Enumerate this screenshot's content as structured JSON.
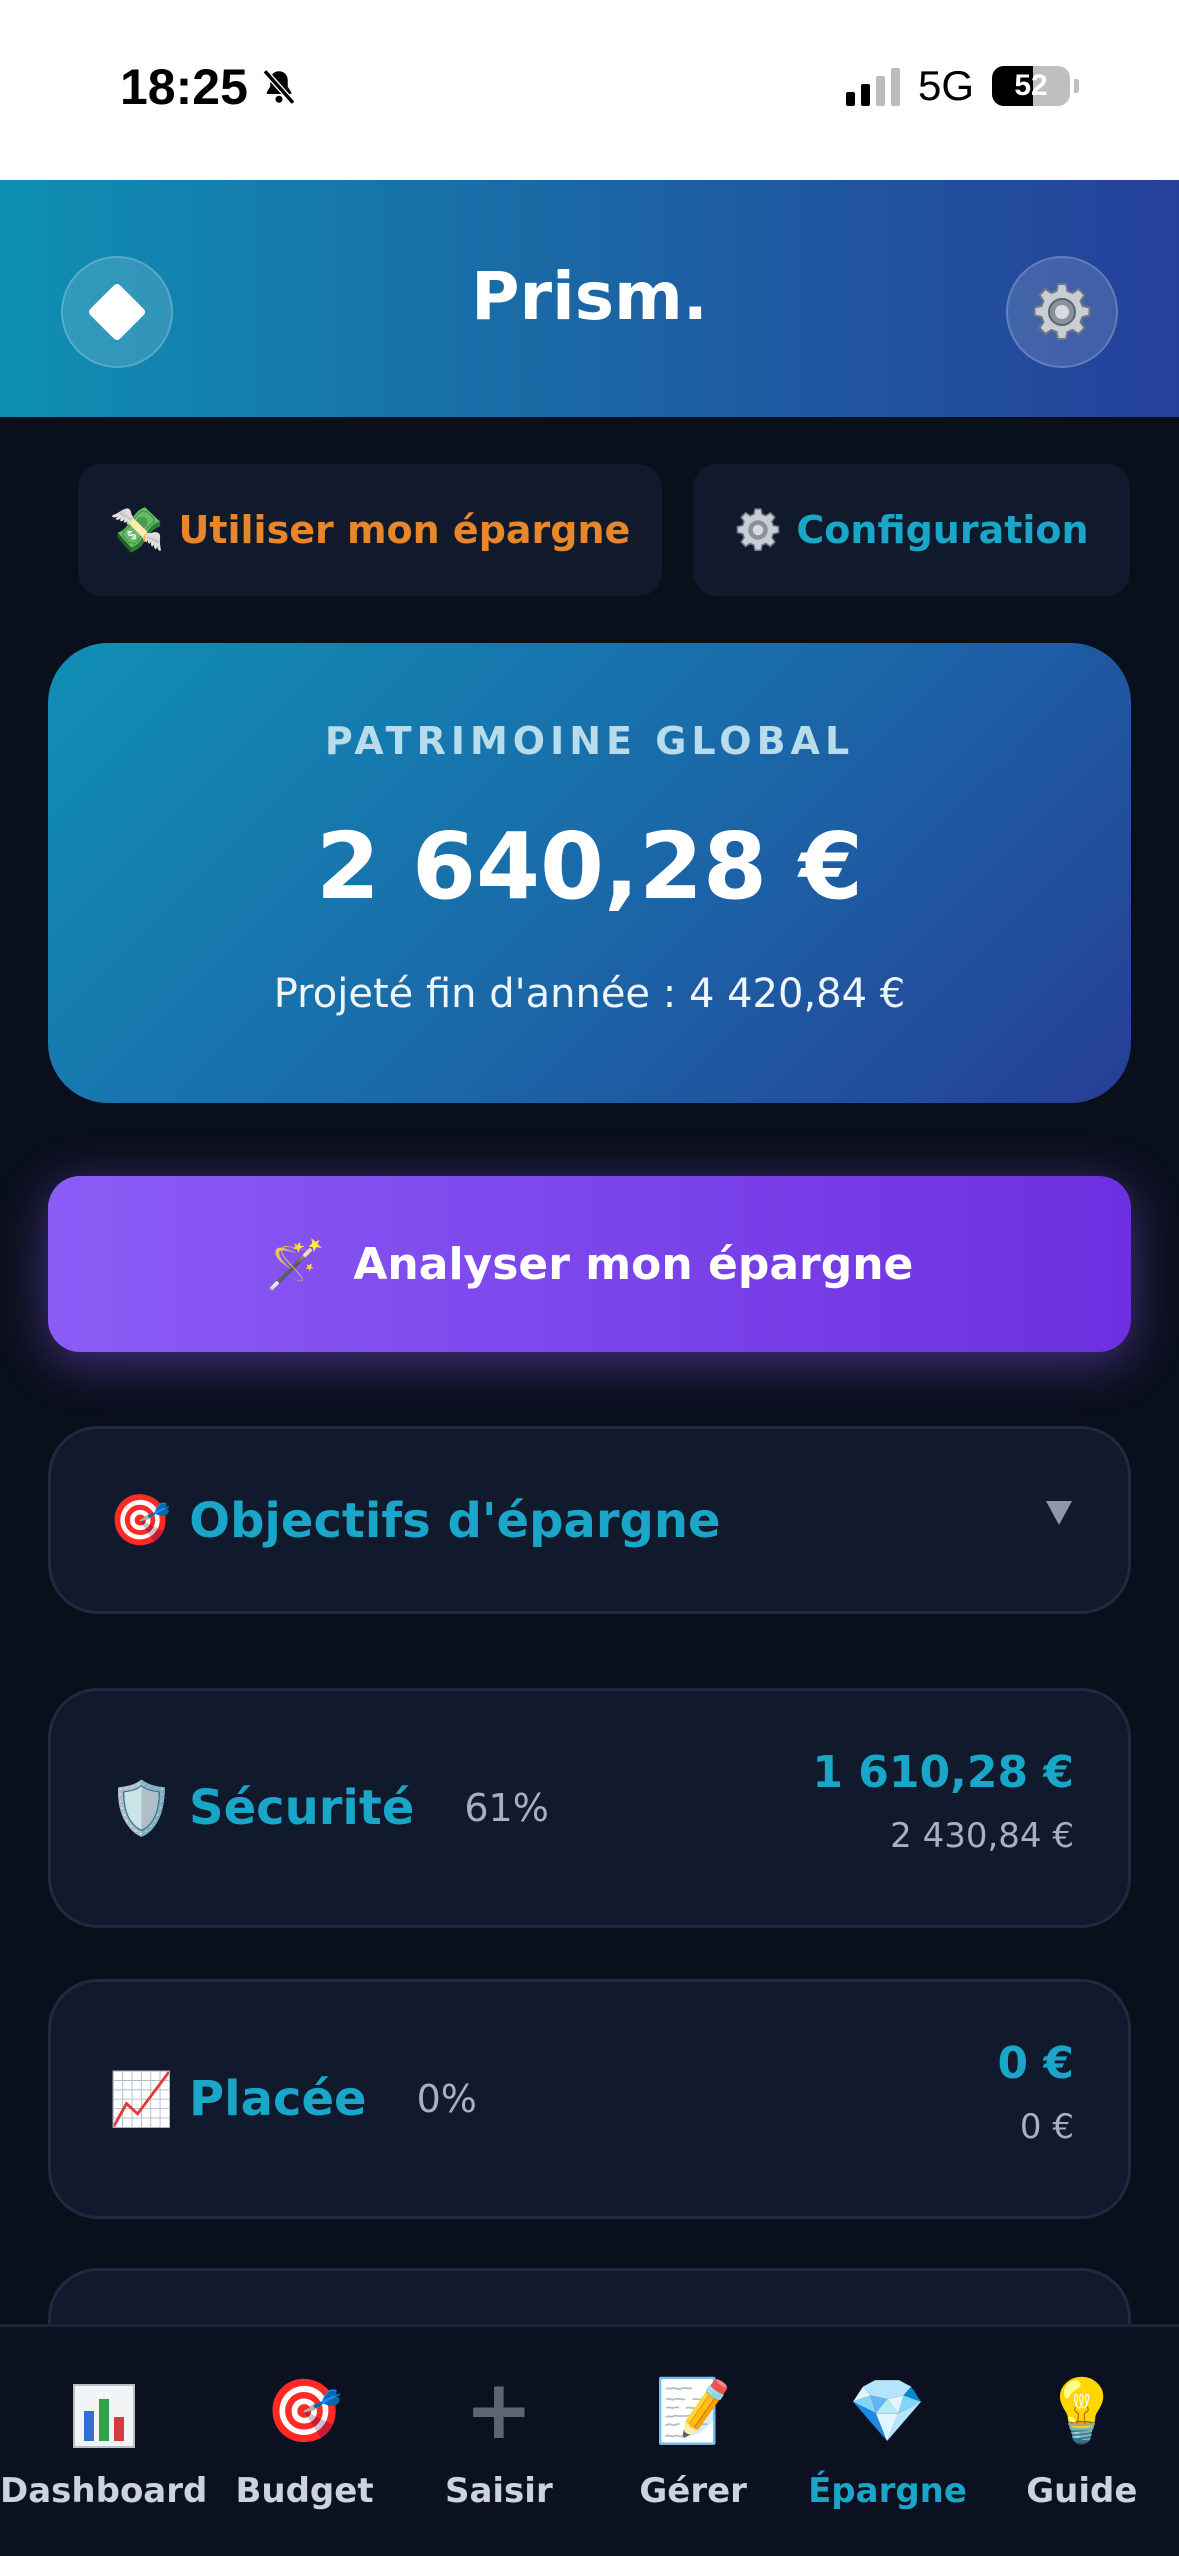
{
  "status_bar": {
    "time": "18:25",
    "network": "5G",
    "battery": "52",
    "battery_level": 0.52
  },
  "header": {
    "title": "Prism."
  },
  "actions": {
    "spend_label": "Utiliser mon épargne",
    "config_label": "Configuration"
  },
  "patrimoine": {
    "label": "PATRIMOINE GLOBAL",
    "value": "2 640,28 €",
    "projected": "Projeté fin d'année : 4 420,84 €"
  },
  "analyze": {
    "label": "Analyser mon épargne"
  },
  "objectives": {
    "title": "Objectifs d'épargne"
  },
  "savings": [
    {
      "name": "Sécurité",
      "percent": "61%",
      "amount": "1 610,28 €",
      "target": "2 430,84 €",
      "icon": "shield-icon"
    },
    {
      "name": "Placée",
      "percent": "0%",
      "amount": "0 €",
      "target": "0 €",
      "icon": "chart-up-icon"
    }
  ],
  "nav": [
    {
      "label": "Dashboard",
      "icon": "bar-chart-icon"
    },
    {
      "label": "Budget",
      "icon": "target-icon"
    },
    {
      "label": "Saisir",
      "icon": "plus-icon"
    },
    {
      "label": "Gérer",
      "icon": "memo-icon"
    },
    {
      "label": "Épargne",
      "icon": "gem-icon",
      "active": true
    },
    {
      "label": "Guide",
      "icon": "lightbulb-icon"
    }
  ],
  "colors": {
    "accent": "#19a6c8",
    "orange": "#e8862a",
    "purple": "#8b5cf6",
    "background": "#0a0f1c",
    "card": "#111a2c"
  }
}
